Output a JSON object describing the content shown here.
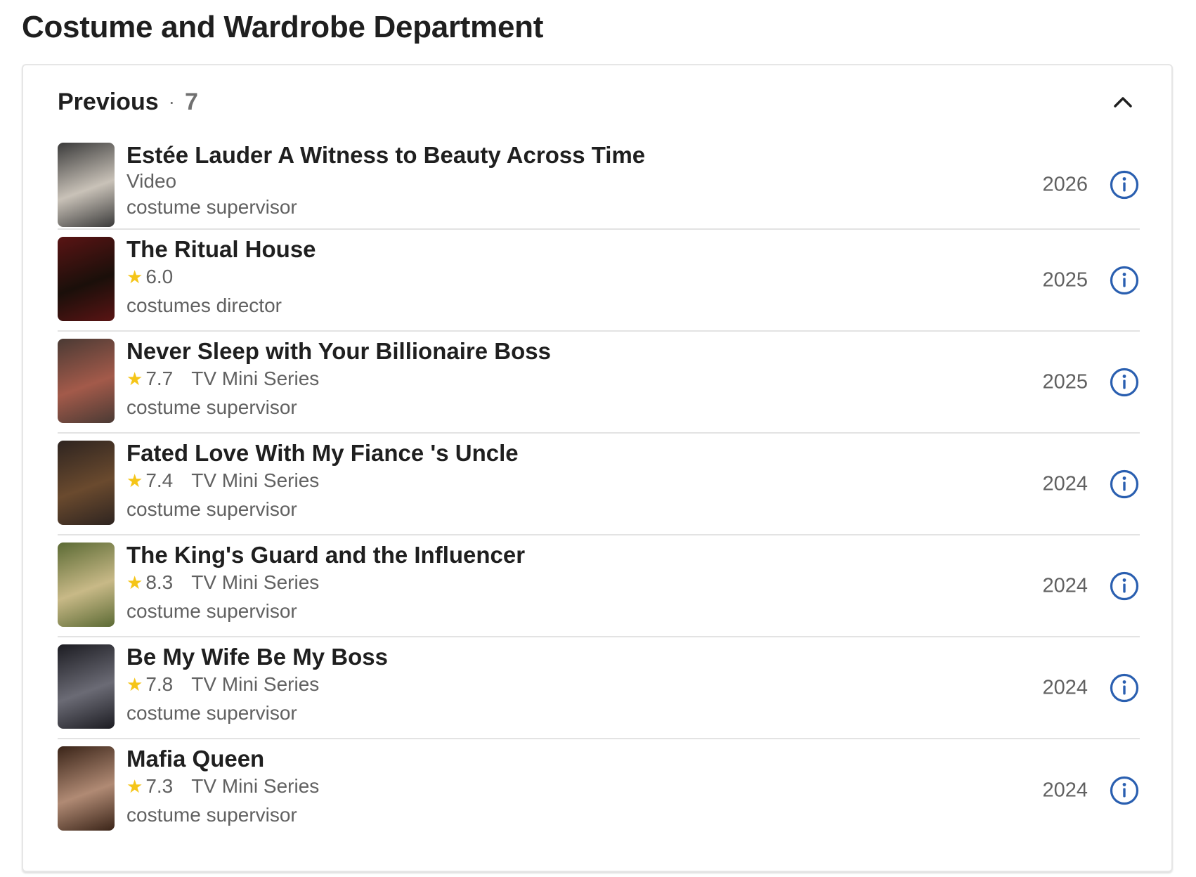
{
  "section_title": "Costume and Wardrobe Department",
  "group": {
    "label": "Previous",
    "separator": "·",
    "count": "7"
  },
  "accent_color": "#2a5fb0",
  "star_color": "#f5c518",
  "credits": [
    {
      "title": "Estée Lauder A Witness to Beauty Across Time",
      "rating": "",
      "type": "Video",
      "role": "costume supervisor",
      "year": "2026",
      "poster_colors": [
        "#3a3a3a",
        "#c9c2b8"
      ]
    },
    {
      "title": "The Ritual House",
      "rating": "6.0",
      "type": "",
      "role": "costumes director",
      "year": "2025",
      "poster_colors": [
        "#5a1414",
        "#1a0f0a"
      ]
    },
    {
      "title": "Never Sleep with Your Billionaire Boss",
      "rating": "7.7",
      "type": "TV Mini Series",
      "role": "costume supervisor",
      "year": "2025",
      "poster_colors": [
        "#4a3a34",
        "#a35a4a"
      ]
    },
    {
      "title": "Fated Love With My Fiance 's Uncle",
      "rating": "7.4",
      "type": "TV Mini Series",
      "role": "costume supervisor",
      "year": "2024",
      "poster_colors": [
        "#2e2420",
        "#6a4a2e"
      ]
    },
    {
      "title": "The King's Guard and the Influencer",
      "rating": "8.3",
      "type": "TV Mini Series",
      "role": "costume supervisor",
      "year": "2024",
      "poster_colors": [
        "#5b6a34",
        "#c8b987"
      ]
    },
    {
      "title": "Be My Wife Be My Boss",
      "rating": "7.8",
      "type": "TV Mini Series",
      "role": "costume supervisor",
      "year": "2024",
      "poster_colors": [
        "#1c1c22",
        "#6b6b75"
      ]
    },
    {
      "title": "Mafia Queen",
      "rating": "7.3",
      "type": "TV Mini Series",
      "role": "costume supervisor",
      "year": "2024",
      "poster_colors": [
        "#3a2418",
        "#b08a74"
      ]
    }
  ]
}
